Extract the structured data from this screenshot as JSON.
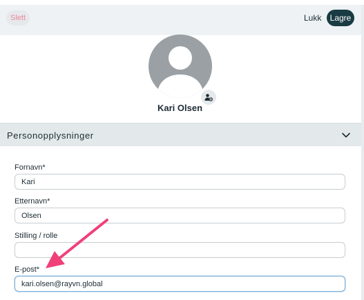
{
  "toolbar": {
    "delete_label": "Slett",
    "close_label": "Lukk",
    "save_label": "Lagre"
  },
  "profile": {
    "name": "Kari Olsen",
    "avatar_icon": "user-silhouette-icon",
    "edit_icon": "user-settings-icon"
  },
  "section": {
    "title": "Personopplysninger",
    "toggle_icon": "chevron-down-icon"
  },
  "form": {
    "first_name": {
      "label": "Fornavn*",
      "value": "Kari"
    },
    "last_name": {
      "label": "Etternavn*",
      "value": "Olsen"
    },
    "role": {
      "label": "Stilling / rolle",
      "value": ""
    },
    "email": {
      "label": "E-post*",
      "value": "kari.olsen@rayvn.global"
    }
  },
  "colors": {
    "accent": "#193b43",
    "annotation_arrow": "#f0407a",
    "delete_text": "#e8879c"
  }
}
